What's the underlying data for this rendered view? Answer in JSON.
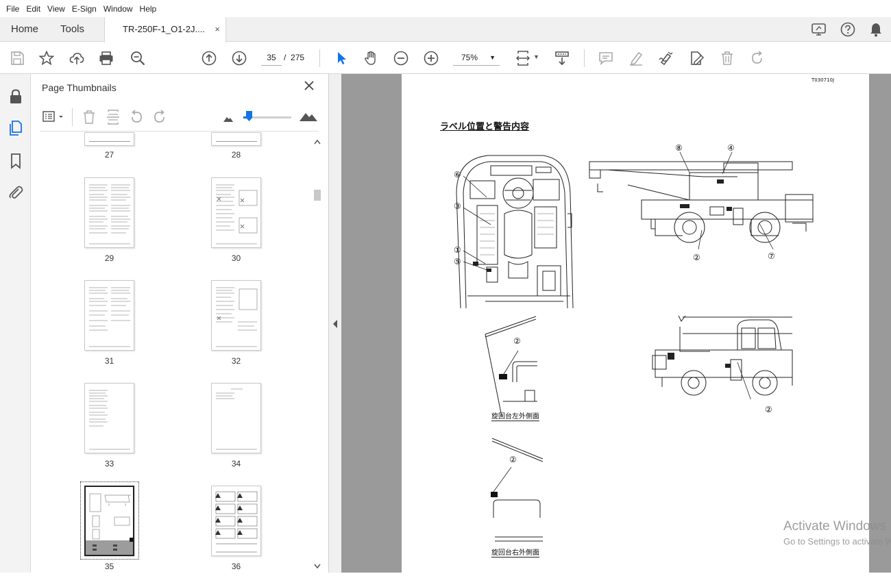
{
  "menu": [
    "File",
    "Edit",
    "View",
    "E-Sign",
    "Window",
    "Help"
  ],
  "tabs": {
    "home": "Home",
    "tools": "Tools",
    "document": "TR-250F-1_O1-2J....",
    "close_glyph": "×"
  },
  "toolbar": {
    "current_page": "35",
    "page_separator": "/",
    "total_pages": "275",
    "zoom": "75%"
  },
  "panel": {
    "title": "Page Thumbnails",
    "thumbnails": [
      {
        "label": "27"
      },
      {
        "label": "28"
      },
      {
        "label": "29"
      },
      {
        "label": "30"
      },
      {
        "label": "31"
      },
      {
        "label": "32"
      },
      {
        "label": "33"
      },
      {
        "label": "34"
      },
      {
        "label": "35",
        "selected": true
      },
      {
        "label": "36"
      }
    ]
  },
  "document": {
    "code": "T030710J",
    "heading": "ラベル位置と警告内容",
    "caption_left": "旋回台左外側面",
    "caption_right": "旋回台右外側面",
    "callouts": [
      "①",
      "②",
      "③",
      "④",
      "⑤",
      "⑥",
      "⑦",
      "⑧"
    ]
  },
  "watermark": {
    "line1": "Activate Windows",
    "line2": "Go to Settings to activate Windows."
  },
  "colors": {
    "accent_blue": "#1473e6",
    "doc_bg": "#9a9a9a",
    "icon_gray": "#555555"
  }
}
